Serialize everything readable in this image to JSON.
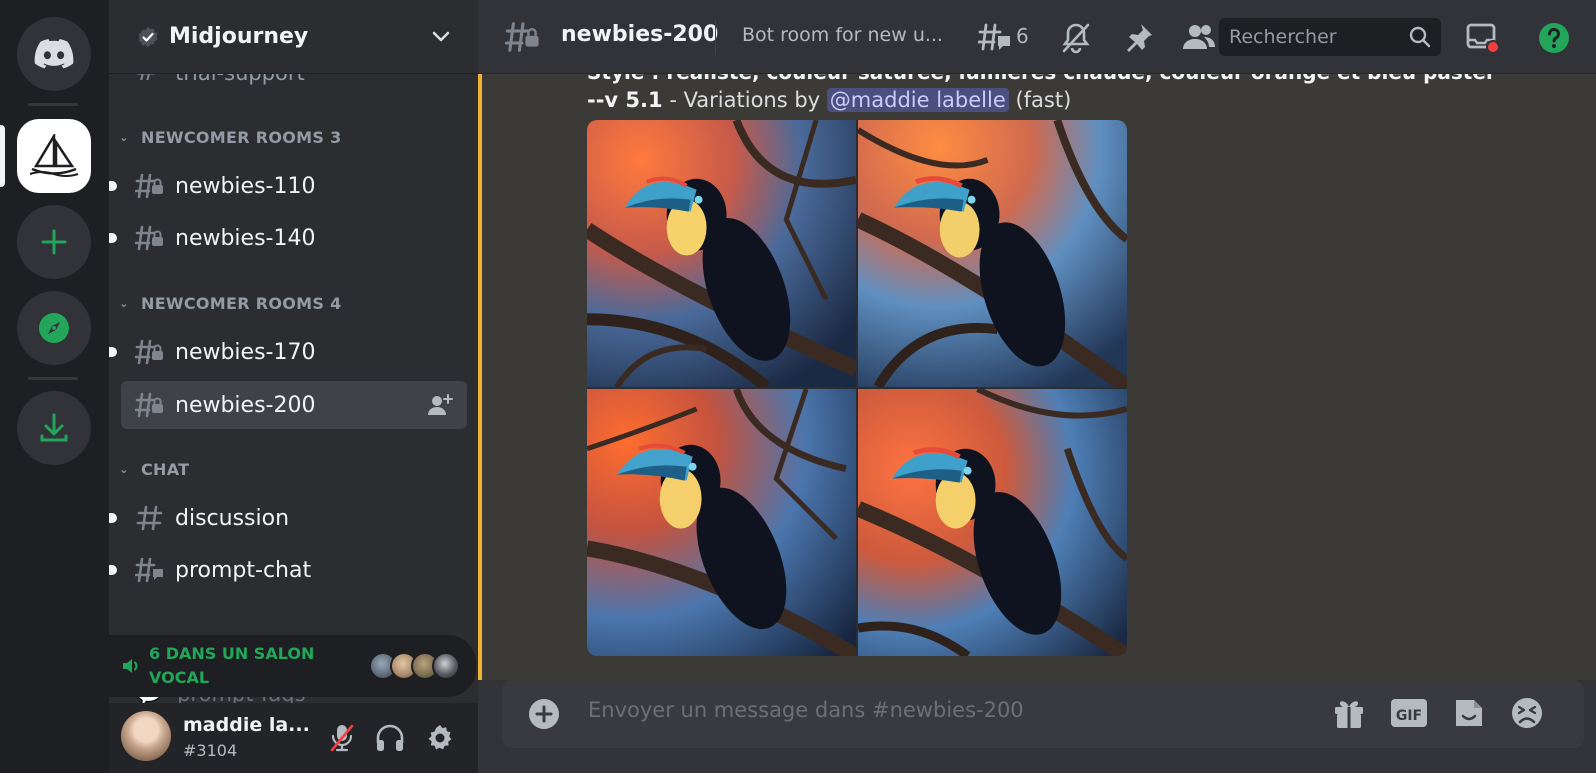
{
  "server": {
    "name": "Midjourney"
  },
  "sidebar": {
    "cut_channel": "trial-support",
    "categories": [
      {
        "label": "NEWCOMER ROOMS 3",
        "channels": [
          {
            "name": "newbies-110"
          },
          {
            "name": "newbies-140"
          }
        ]
      },
      {
        "label": "NEWCOMER ROOMS 4",
        "channels": [
          {
            "name": "newbies-170"
          },
          {
            "name": "newbies-200"
          }
        ]
      },
      {
        "label": "CHAT",
        "channels": [
          {
            "name": "discussion"
          },
          {
            "name": "prompt-chat"
          }
        ]
      }
    ],
    "faded_channel": "prompt-faqs"
  },
  "voice": {
    "label": "6 DANS UN SALON VOCAL",
    "avatar_colors": [
      "#5d6b7a",
      "#a9896a",
      "#7c6b4f",
      "#3b3c40"
    ]
  },
  "user": {
    "name": "maddie la...",
    "tag": "#3104"
  },
  "channel": {
    "name": "newbies-200",
    "topic": "Bot room for new u...",
    "threads_count": "6"
  },
  "search": {
    "placeholder": "Rechercher"
  },
  "message": {
    "cut_line": "Style : réaliste, couleur saturée, lumières chaude, couleur orange et bleu pastel",
    "version": "--v 5.1",
    "variations_text": " - Variations by ",
    "mention": "@maddie labelle",
    "speed": " (fast)"
  },
  "composer": {
    "placeholder": "Envoyer un message dans #newbies-200"
  },
  "colors": {
    "accent_green": "#23a55a",
    "mention_bg": "#4b4f7d",
    "highlight_bar": "#f0b232",
    "rail_bg": "#1e1f22",
    "sidebar_bg": "#2b2d31",
    "main_bg": "#313338"
  },
  "icons": {
    "rail": [
      "discord-logo-icon",
      "midjourney-server-icon",
      "add-server-icon",
      "explore-compass-icon",
      "download-icon"
    ],
    "topbar": [
      "threads-icon",
      "mute-notifications-icon",
      "pinned-icon",
      "member-list-icon",
      "search-icon",
      "inbox-icon",
      "help-icon"
    ],
    "composer": [
      "attach-plus-icon",
      "gift-icon",
      "gif-icon",
      "sticker-icon",
      "emoji-icon"
    ]
  }
}
